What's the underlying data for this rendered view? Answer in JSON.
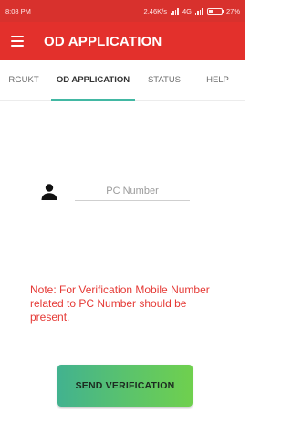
{
  "status_bar": {
    "time": "8:08 PM",
    "network_speed": "2.46K/s",
    "network_type": "4G",
    "battery": "27%"
  },
  "toolbar": {
    "menu_icon": "hamburger-menu-icon",
    "title": "OD APPLICATION"
  },
  "tabs": [
    {
      "label": "RGUKT",
      "active": false
    },
    {
      "label": "OD APPLICATION",
      "active": true
    },
    {
      "label": "STATUS",
      "active": false
    },
    {
      "label": "HELP",
      "active": false
    }
  ],
  "form": {
    "person_icon": "person-icon",
    "pc_number_placeholder": "PC Number",
    "pc_number_value": ""
  },
  "note": "Note: For Verification Mobile Number related to PC Number should be present.",
  "button": {
    "label": "SEND VERIFICATION"
  },
  "colors": {
    "status_bar": "#d8312d",
    "toolbar": "#e3302c",
    "tab_indicator": "#42b8a3",
    "note_text": "#e53935",
    "button_gradient_start": "#42b28f",
    "button_gradient_end": "#6fd04e"
  }
}
